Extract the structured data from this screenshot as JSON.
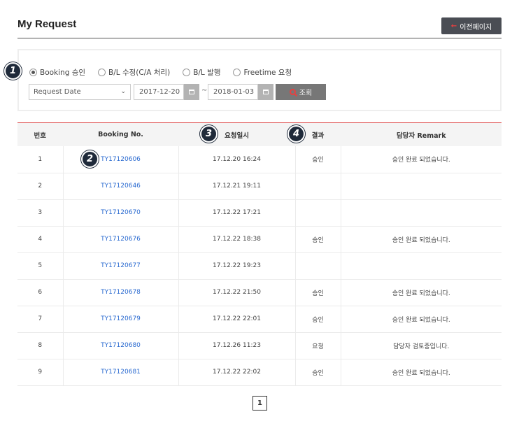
{
  "page": {
    "title": "My Request",
    "back_label": "이전페이지",
    "back_arrow": "←"
  },
  "filter": {
    "radios": [
      {
        "label": "Booking 승인",
        "checked": true
      },
      {
        "label": "B/L 수정(C/A 처리)",
        "checked": false
      },
      {
        "label": "B/L 발행",
        "checked": false
      },
      {
        "label": "Freetime 요청",
        "checked": false
      }
    ],
    "date_type": "Request Date",
    "date_from": "2017-12-20",
    "date_to": "2018-01-03",
    "tilde": "~",
    "search_label": "조회"
  },
  "table": {
    "headers": [
      "번호",
      "Booking No.",
      "요청일시",
      "결과",
      "담당자 Remark"
    ],
    "rows": [
      [
        "1",
        "TY17120606",
        "17.12.20 16:24",
        "승인",
        "승인 완료 되었습니다."
      ],
      [
        "2",
        "TY17120646",
        "17.12.21 19:11",
        "",
        ""
      ],
      [
        "3",
        "TY17120670",
        "17.12.22 17:21",
        "",
        ""
      ],
      [
        "4",
        "TY17120676",
        "17.12.22 18:38",
        "승인",
        "승인 완료 되었습니다."
      ],
      [
        "5",
        "TY17120677",
        "17.12.22 19:23",
        "",
        ""
      ],
      [
        "6",
        "TY17120678",
        "17.12.22 21:50",
        "승인",
        "승인 완료 되었습니다."
      ],
      [
        "7",
        "TY17120679",
        "17.12.22 22:01",
        "승인",
        "승인 완료 되었습니다."
      ],
      [
        "8",
        "TY17120680",
        "17.12.26 11:23",
        "요청",
        "담당자 검토중입니다."
      ],
      [
        "9",
        "TY17120681",
        "17.12.22 22:02",
        "승인",
        "승인 완료 되었습니다."
      ]
    ]
  },
  "badges": [
    "1",
    "2",
    "3",
    "4"
  ],
  "pagination": {
    "current": "1"
  },
  "colors": {
    "accent": "#e05050",
    "link": "#2a6ad0",
    "badge": "#1f2a3a"
  }
}
